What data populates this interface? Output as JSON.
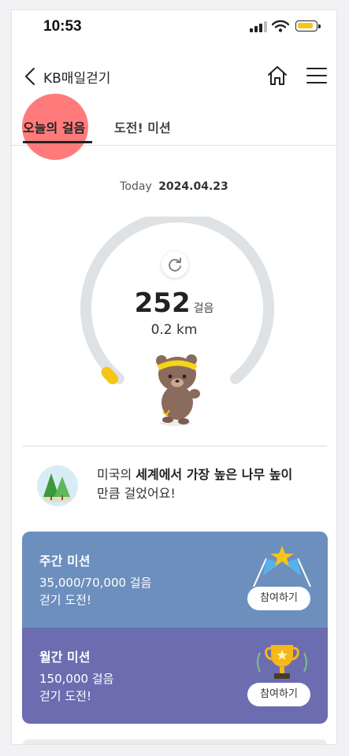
{
  "status": {
    "time": "10:53"
  },
  "header": {
    "title": "KB매일걷기"
  },
  "tabs": {
    "today": "오늘의 걸음",
    "mission": "도전! 미션"
  },
  "date": {
    "label": "Today",
    "value": "2024.04.23"
  },
  "gauge": {
    "steps": "252",
    "steps_unit": "걸음",
    "distance": "0.2 km",
    "progress": 0.02
  },
  "achievement": {
    "prefix": "미국의 ",
    "highlight": "세계에서 가장 높은 나무 높이",
    "suffix": "만큼 걸었어요!"
  },
  "missions": [
    {
      "title": "주간 미션",
      "goal": "35,000/70,000 걸음",
      "desc": "걷기 도전!",
      "button": "참여하기"
    },
    {
      "title": "월간 미션",
      "goal": "150,000 걸음",
      "desc": "걷기 도전!",
      "button": "참여하기"
    }
  ],
  "colors": {
    "accent": "#f5c518",
    "weekly": "#6d8fbe",
    "monthly": "#6b6db0",
    "highlight": "#ff7070"
  }
}
